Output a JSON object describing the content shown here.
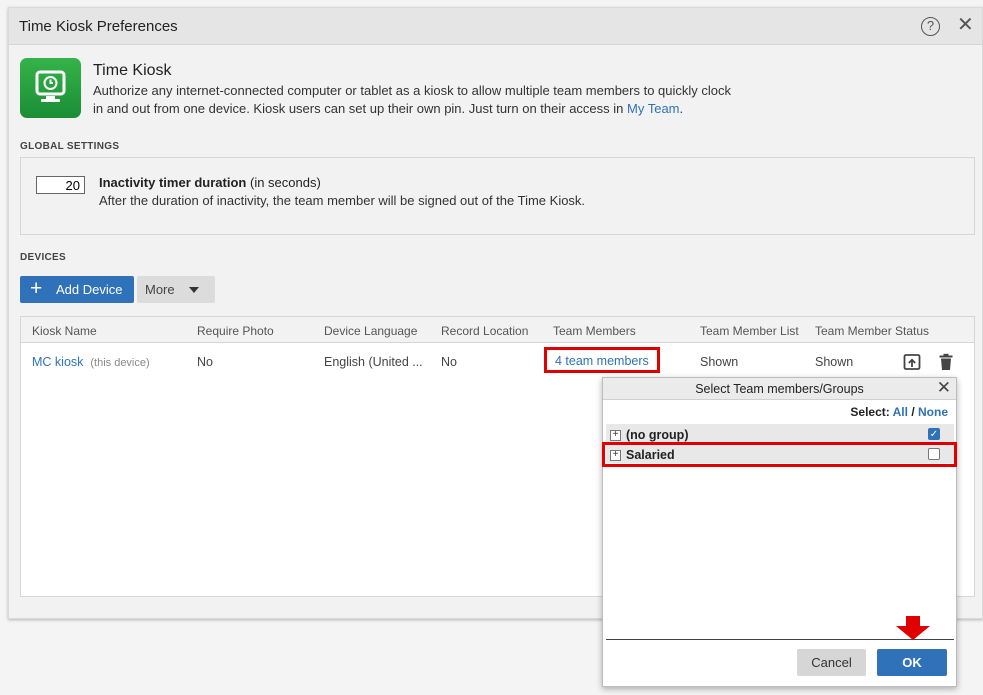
{
  "dialog": {
    "title": "Time Kiosk Preferences"
  },
  "intro": {
    "title": "Time Kiosk",
    "description_1": "Authorize any internet-connected computer or tablet as a kiosk to allow multiple team members to quickly clock",
    "description_2": "in and out from one device. Kiosk users can set up their own pin. Just turn on their access in ",
    "link": "My Team",
    "suffix": "."
  },
  "global_settings": {
    "section_label": "GLOBAL SETTINGS",
    "timer_value": "20",
    "timer_title": "Inactivity timer duration",
    "timer_unit": " (in seconds)",
    "timer_desc": "After the duration of inactivity, the team member will be signed out of the Time Kiosk."
  },
  "devices": {
    "section_label": "DEVICES",
    "add_device_label": "Add Device",
    "more_label": "More",
    "columns": [
      "Kiosk Name",
      "Require Photo",
      "Device Language",
      "Record Location",
      "Team Members",
      "Team Member List",
      "Team Member Status"
    ],
    "rows": [
      {
        "kiosk_name": "MC kiosk",
        "kiosk_note": "(this device)",
        "require_photo": "No",
        "device_language": "English (United ...",
        "record_location": "No",
        "team_members": "4 team members",
        "team_member_list": "Shown",
        "team_member_status": "Shown"
      }
    ]
  },
  "popup": {
    "title": "Select Team members/Groups",
    "select_label": "Select:",
    "select_all": "All",
    "separator": " / ",
    "select_none": "None",
    "groups": [
      {
        "label": "(no group)",
        "checked": true
      },
      {
        "label": "Salaried",
        "checked": false
      }
    ],
    "cancel_label": "Cancel",
    "ok_label": "OK"
  },
  "colors": {
    "accent": "#2f72b9",
    "highlight": "#e00000",
    "app_icon": "#2aa140"
  }
}
